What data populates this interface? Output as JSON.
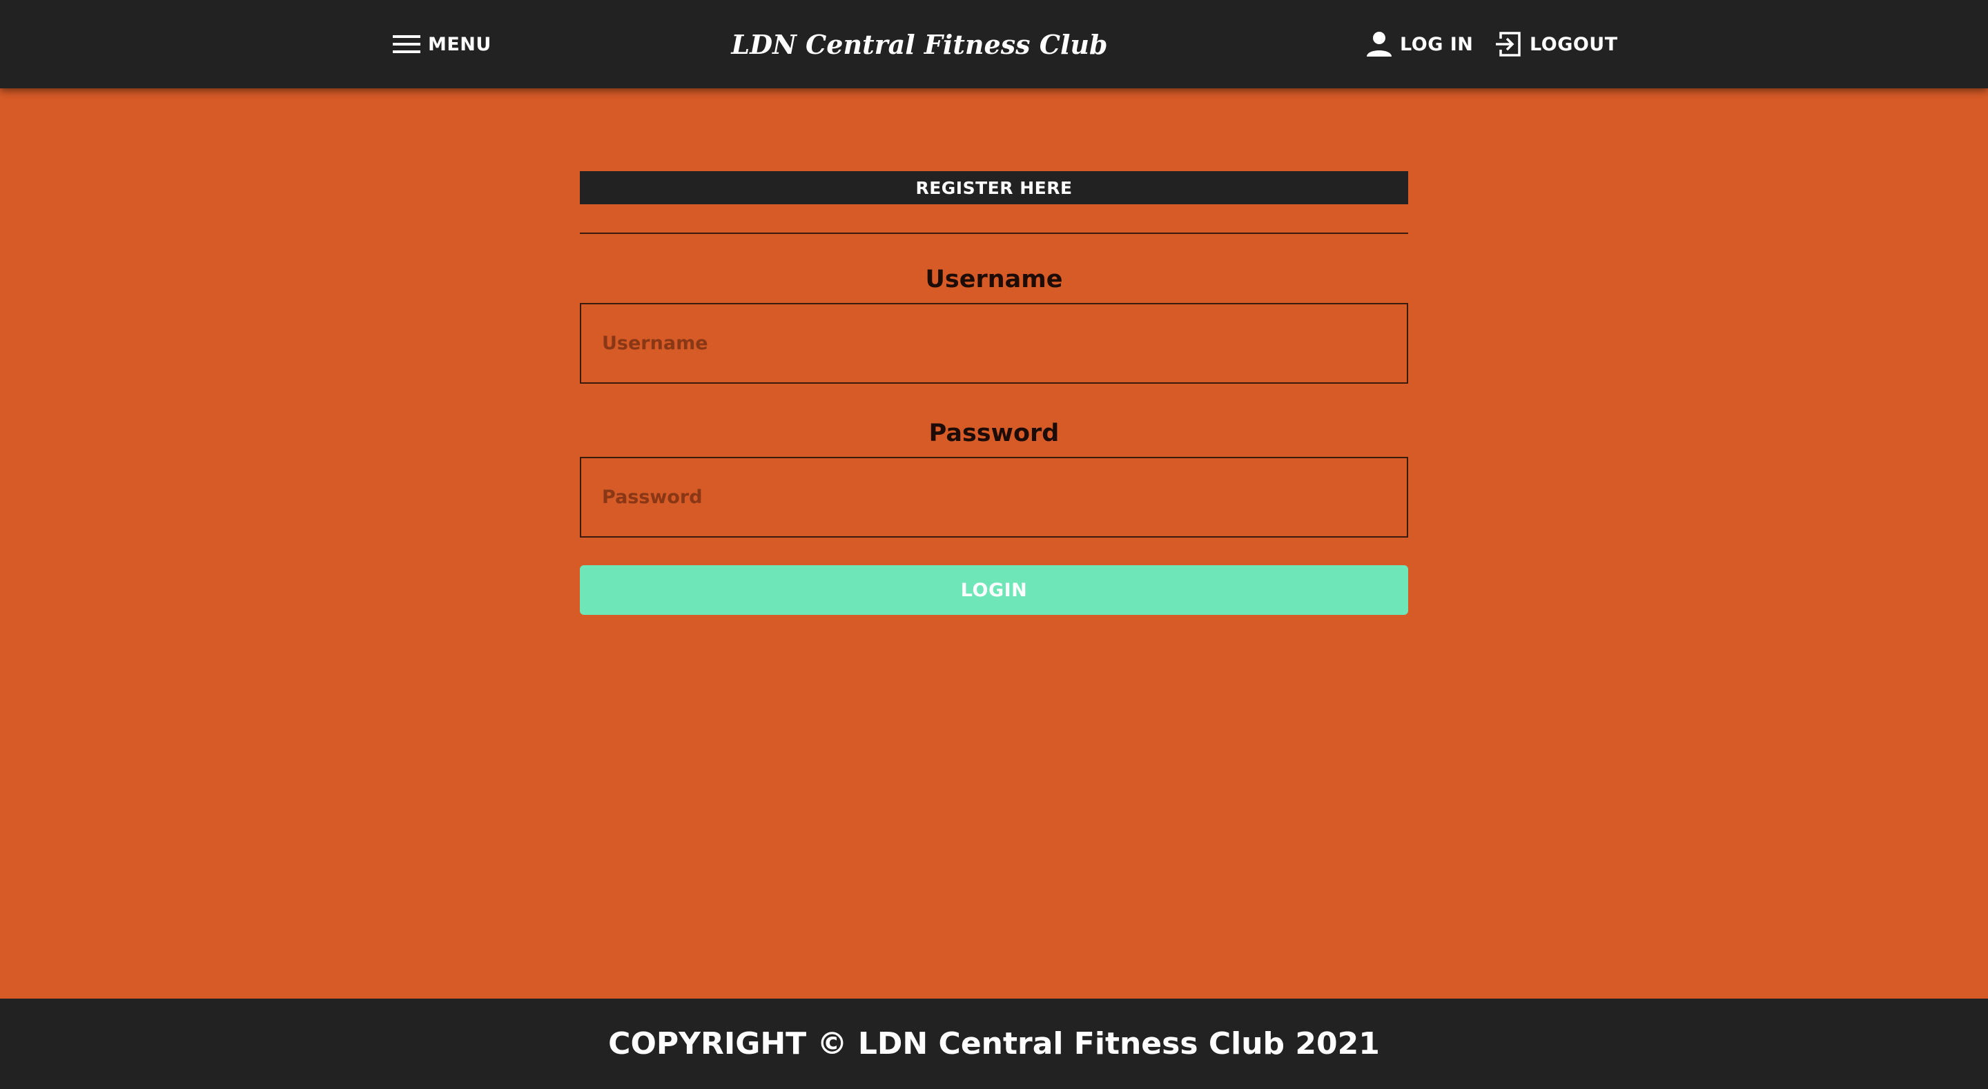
{
  "colors": {
    "page_background": "#d65b27",
    "bar_background": "#222222",
    "login_button": "#6ee6b8",
    "text_light": "#ffffff",
    "text_dark": "#1c0c05"
  },
  "nav": {
    "menu_label": "MENU",
    "menu_icon": "hamburger-menu-icon",
    "brand": "LDN Central Fitness Club",
    "login_label": "LOG IN",
    "login_icon": "user-icon",
    "logout_label": "LOGOUT",
    "logout_icon": "logout-icon"
  },
  "form": {
    "register_label": "REGISTER HERE",
    "username_label": "Username",
    "username_placeholder": "Username",
    "username_value": "",
    "password_label": "Password",
    "password_placeholder": "Password",
    "password_value": "",
    "submit_label": "LOGIN"
  },
  "footer": {
    "copyright": "COPYRIGHT © LDN Central Fitness Club 2021"
  }
}
